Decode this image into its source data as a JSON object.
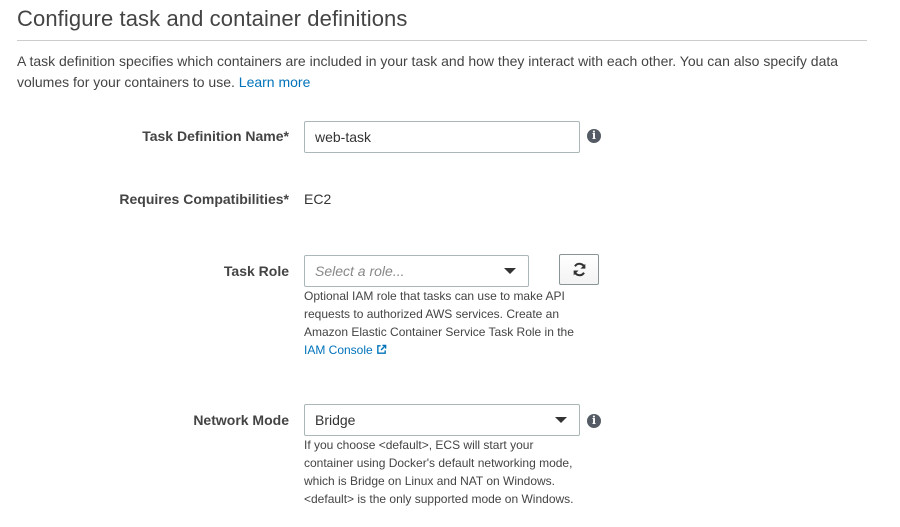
{
  "header": {
    "title": "Configure task and container definitions",
    "description": "A task definition specifies which containers are included in your task and how they interact with each other. You can also specify data volumes for your containers to use.",
    "learn_more": "Learn more"
  },
  "form": {
    "task_definition_name": {
      "label": "Task Definition Name*",
      "value": "web-task"
    },
    "requires_compatibilities": {
      "label": "Requires Compatibilities*",
      "value": "EC2"
    },
    "task_role": {
      "label": "Task Role",
      "placeholder": "Select a role...",
      "help": "Optional IAM role that tasks can use to make API requests to authorized AWS services. Create an Amazon Elastic Container Service Task Role in the",
      "help_link": "IAM Console"
    },
    "network_mode": {
      "label": "Network Mode",
      "value": "Bridge",
      "help": "If you choose <default>, ECS will start your container using Docker's default networking mode, which is Bridge on Linux and NAT on Windows. <default> is the only supported mode on Windows."
    }
  },
  "colors": {
    "link": "#0073bb",
    "text": "#444444",
    "border": "#aab7b8"
  }
}
